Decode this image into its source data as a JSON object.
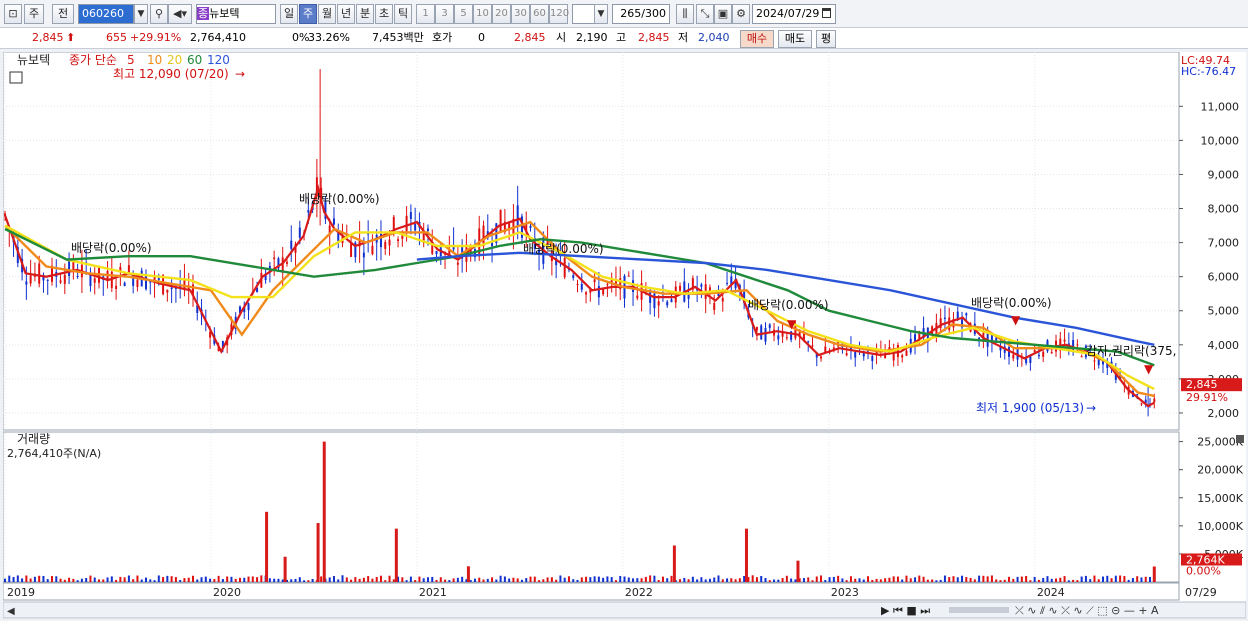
{
  "toolbar": {
    "tab_stock": "주",
    "tab_prev": "전",
    "code": "060260",
    "stock_badge": "종",
    "stock_name": "뉴보텍",
    "periods": [
      "일",
      "주",
      "월",
      "년",
      "분",
      "초",
      "틱"
    ],
    "selected_period": "주",
    "minutes": [
      "1",
      "3",
      "5",
      "10",
      "20",
      "30",
      "60",
      "120"
    ],
    "count": "265",
    "count_total": "/300",
    "date": "2024/07/29"
  },
  "quote": {
    "price": "2,845",
    "change": "655",
    "change_pct": "+29.91%",
    "volume": "2,764,410",
    "ratio1": "0%",
    "ratio2": "33.26%",
    "amount": "7,453백만",
    "hoga_label": "호가",
    "hoga_value": "0",
    "last": "2,845",
    "open_label": "시",
    "open": "2,190",
    "high_label": "고",
    "high": "2,845",
    "low_label": "저",
    "low": "2,040",
    "buy": "매수",
    "sell": "매도",
    "eval": "평"
  },
  "price_panel": {
    "stock_name": "뉴보텍",
    "ma_title": "종가 단순",
    "ma_periods": [
      "5",
      "10",
      "20",
      "60",
      "120"
    ],
    "ma_colors": [
      "#d81a1a",
      "#f08a1a",
      "#f3e21a",
      "#1f8a3a",
      "#2a55d8"
    ],
    "lc": "LC:49.74",
    "hc": "HC:-76.47",
    "max_label": "최고 12,090 (07/20)",
    "min_label": "최저 1,900 (05/13)",
    "annotations": [
      "배당락(0.00%)",
      "배당락(0.00%)",
      "배당락(0.00%)",
      "배당락(0.00%)",
      "배당락(0.00%)",
      "감자,권리락(375,"
    ],
    "current_price_tag": "2,845",
    "current_pct_tag": "29.91%"
  },
  "volume_panel": {
    "title": "거래량",
    "value": "2,764,410주(N/A)",
    "current_tag": "2,764K",
    "pct_tag": "0.00%"
  },
  "chart_data": [
    {
      "type": "line",
      "title": "뉴보텍",
      "y_ticks": [
        "2,000",
        "3,000",
        "4,000",
        "5,000",
        "6,000",
        "7,000",
        "8,000",
        "9,000",
        "10,000",
        "11,000"
      ],
      "ylim": [
        1500,
        12300
      ],
      "x_labels": [
        "2019",
        "2020",
        "2021",
        "2022",
        "2023",
        "2024",
        "07/29"
      ],
      "xlim": [
        2019.0,
        2024.7
      ],
      "series": [
        {
          "name": "5",
          "values_x": [
            2019.0,
            2019.1,
            2019.2,
            2019.35,
            2019.5,
            2019.6,
            2019.75,
            2019.9,
            2020.05,
            2020.15,
            2020.25,
            2020.35,
            2020.45,
            2020.52,
            2020.55,
            2020.6,
            2020.7,
            2020.8,
            2020.9,
            2021.0,
            2021.1,
            2021.2,
            2021.3,
            2021.4,
            2021.5,
            2021.55,
            2021.65,
            2021.75,
            2021.85,
            2021.95,
            2022.05,
            2022.15,
            2022.25,
            2022.35,
            2022.45,
            2022.55,
            2022.65,
            2022.75,
            2022.85,
            2022.95,
            2023.05,
            2023.15,
            2023.25,
            2023.35,
            2023.45,
            2023.55,
            2023.65,
            2023.75,
            2023.85,
            2023.95,
            2024.05,
            2024.15,
            2024.25,
            2024.35,
            2024.45,
            2024.55,
            2024.58
          ],
          "values": [
            7800,
            6100,
            6000,
            6200,
            5900,
            6100,
            5800,
            5600,
            3800,
            5000,
            6000,
            6400,
            7200,
            8600,
            7900,
            7400,
            6900,
            7100,
            7400,
            7600,
            6800,
            6500,
            7000,
            7500,
            7700,
            7100,
            6600,
            6200,
            5600,
            5700,
            5700,
            5400,
            5400,
            5700,
            5300,
            5900,
            4300,
            4400,
            4300,
            3700,
            3900,
            3800,
            3700,
            3800,
            4200,
            4600,
            4800,
            4200,
            3900,
            3600,
            3900,
            4000,
            3800,
            3500,
            2700,
            2200,
            2300
          ]
        },
        {
          "name": "10",
          "values_x": [
            2019.0,
            2019.2,
            2019.4,
            2019.6,
            2019.8,
            2020.0,
            2020.15,
            2020.3,
            2020.45,
            2020.6,
            2020.75,
            2020.9,
            2021.05,
            2021.2,
            2021.35,
            2021.55,
            2021.7,
            2021.85,
            2022.0,
            2022.2,
            2022.4,
            2022.6,
            2022.75,
            2022.9,
            2023.05,
            2023.25,
            2023.45,
            2023.6,
            2023.75,
            2023.9,
            2024.05,
            2024.2,
            2024.35,
            2024.5,
            2024.58
          ],
          "values": [
            7500,
            6300,
            6100,
            6000,
            5800,
            5600,
            4300,
            5600,
            6500,
            7400,
            7000,
            7300,
            7300,
            6600,
            7200,
            7600,
            6700,
            6000,
            5700,
            5500,
            5500,
            5600,
            4700,
            4300,
            4000,
            3800,
            4000,
            4600,
            4500,
            3900,
            3900,
            3900,
            3500,
            2600,
            2500
          ]
        },
        {
          "name": "20",
          "values_x": [
            2019.0,
            2019.3,
            2019.6,
            2019.9,
            2020.1,
            2020.3,
            2020.5,
            2020.7,
            2020.9,
            2021.1,
            2021.3,
            2021.5,
            2021.7,
            2021.9,
            2022.1,
            2022.3,
            2022.5,
            2022.7,
            2022.9,
            2023.1,
            2023.3,
            2023.5,
            2023.7,
            2023.9,
            2024.1,
            2024.3,
            2024.45,
            2024.58
          ],
          "values": [
            7500,
            6500,
            6100,
            5900,
            5400,
            5400,
            6600,
            7300,
            7300,
            6900,
            6900,
            7300,
            6700,
            6000,
            5700,
            5500,
            5600,
            5000,
            4400,
            4000,
            3800,
            4200,
            4500,
            4100,
            3900,
            3700,
            3100,
            2700
          ]
        },
        {
          "name": "60",
          "values_x": [
            2019.0,
            2019.3,
            2019.6,
            2019.9,
            2020.2,
            2020.5,
            2020.8,
            2021.0,
            2021.2,
            2021.4,
            2021.6,
            2021.8,
            2022.0,
            2022.2,
            2022.4,
            2022.6,
            2022.8,
            2023.0,
            2023.2,
            2023.4,
            2023.6,
            2023.8,
            2024.0,
            2024.2,
            2024.4,
            2024.58
          ],
          "values": [
            7400,
            6500,
            6600,
            6600,
            6300,
            6000,
            6200,
            6400,
            6600,
            6900,
            7100,
            7000,
            6800,
            6600,
            6400,
            6000,
            5600,
            5000,
            4700,
            4400,
            4200,
            4100,
            4000,
            3900,
            3800,
            3400
          ]
        },
        {
          "name": "120",
          "values_x": [
            2021.0,
            2021.2,
            2021.5,
            2021.8,
            2022.1,
            2022.4,
            2022.7,
            2023.0,
            2023.3,
            2023.6,
            2023.9,
            2024.2,
            2024.5,
            2024.58
          ],
          "values": [
            6500,
            6600,
            6700,
            6600,
            6500,
            6400,
            6200,
            5900,
            5600,
            5200,
            4800,
            4500,
            4100,
            4000
          ]
        }
      ]
    },
    {
      "type": "bar",
      "title": "거래량",
      "y_ticks": [
        "5,000K",
        "10,000K",
        "15,000K",
        "20,000K",
        "25,000K"
      ],
      "ylim": [
        0,
        26000
      ],
      "series": [
        {
          "name": "거래량",
          "values_x": [
            2020.27,
            2020.36,
            2020.52,
            2020.55,
            2020.9,
            2021.25,
            2022.25,
            2022.6,
            2022.85,
            2024.58
          ],
          "values": [
            12500,
            4500,
            10500,
            25000,
            9500,
            2800,
            6500,
            9500,
            3800,
            2764
          ]
        }
      ]
    }
  ]
}
